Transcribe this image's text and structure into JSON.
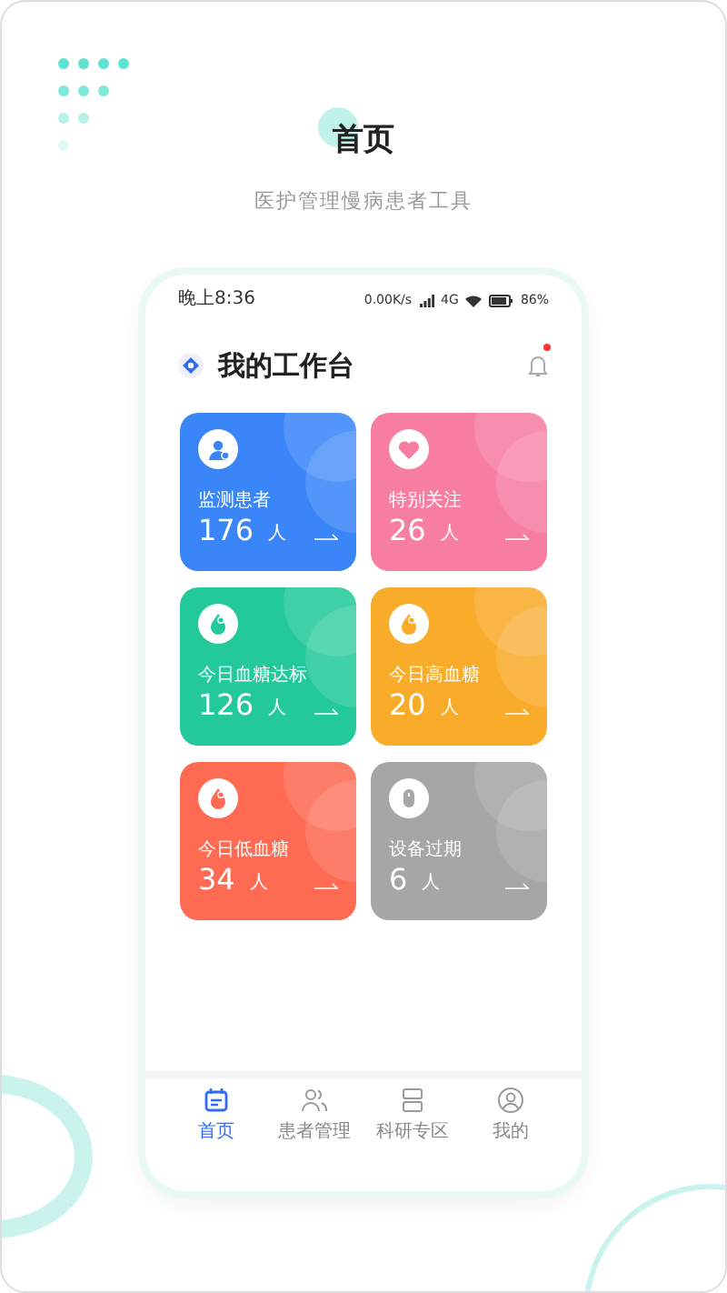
{
  "promo": {
    "title": "首页",
    "subtitle": "医护管理慢病患者工具"
  },
  "status_bar": {
    "time": "晚上8:36",
    "speed": "0.00K/s",
    "network": "4G",
    "battery": "86%"
  },
  "header": {
    "title": "我的工作台",
    "notification_dot": true
  },
  "cards": [
    {
      "title": "监测患者",
      "count": "176",
      "unit": "人",
      "color": "#3a86f8"
    },
    {
      "title": "特别关注",
      "count": "26",
      "unit": "人",
      "color": "#f77ea1"
    },
    {
      "title": "今日血糖达标",
      "count": "126",
      "unit": "人",
      "color": "#23c99a"
    },
    {
      "title": "今日高血糖",
      "count": "20",
      "unit": "人",
      "color": "#f9ab2a"
    },
    {
      "title": "今日低血糖",
      "count": "34",
      "unit": "人",
      "color": "#fe6a52"
    },
    {
      "title": "设备过期",
      "count": "6",
      "unit": "人",
      "color": "#a6a6a6"
    }
  ],
  "tabs": [
    {
      "label": "首页",
      "selected": true
    },
    {
      "label": "患者管理",
      "selected": false
    },
    {
      "label": "科研专区",
      "selected": false
    },
    {
      "label": "我的",
      "selected": false
    }
  ]
}
